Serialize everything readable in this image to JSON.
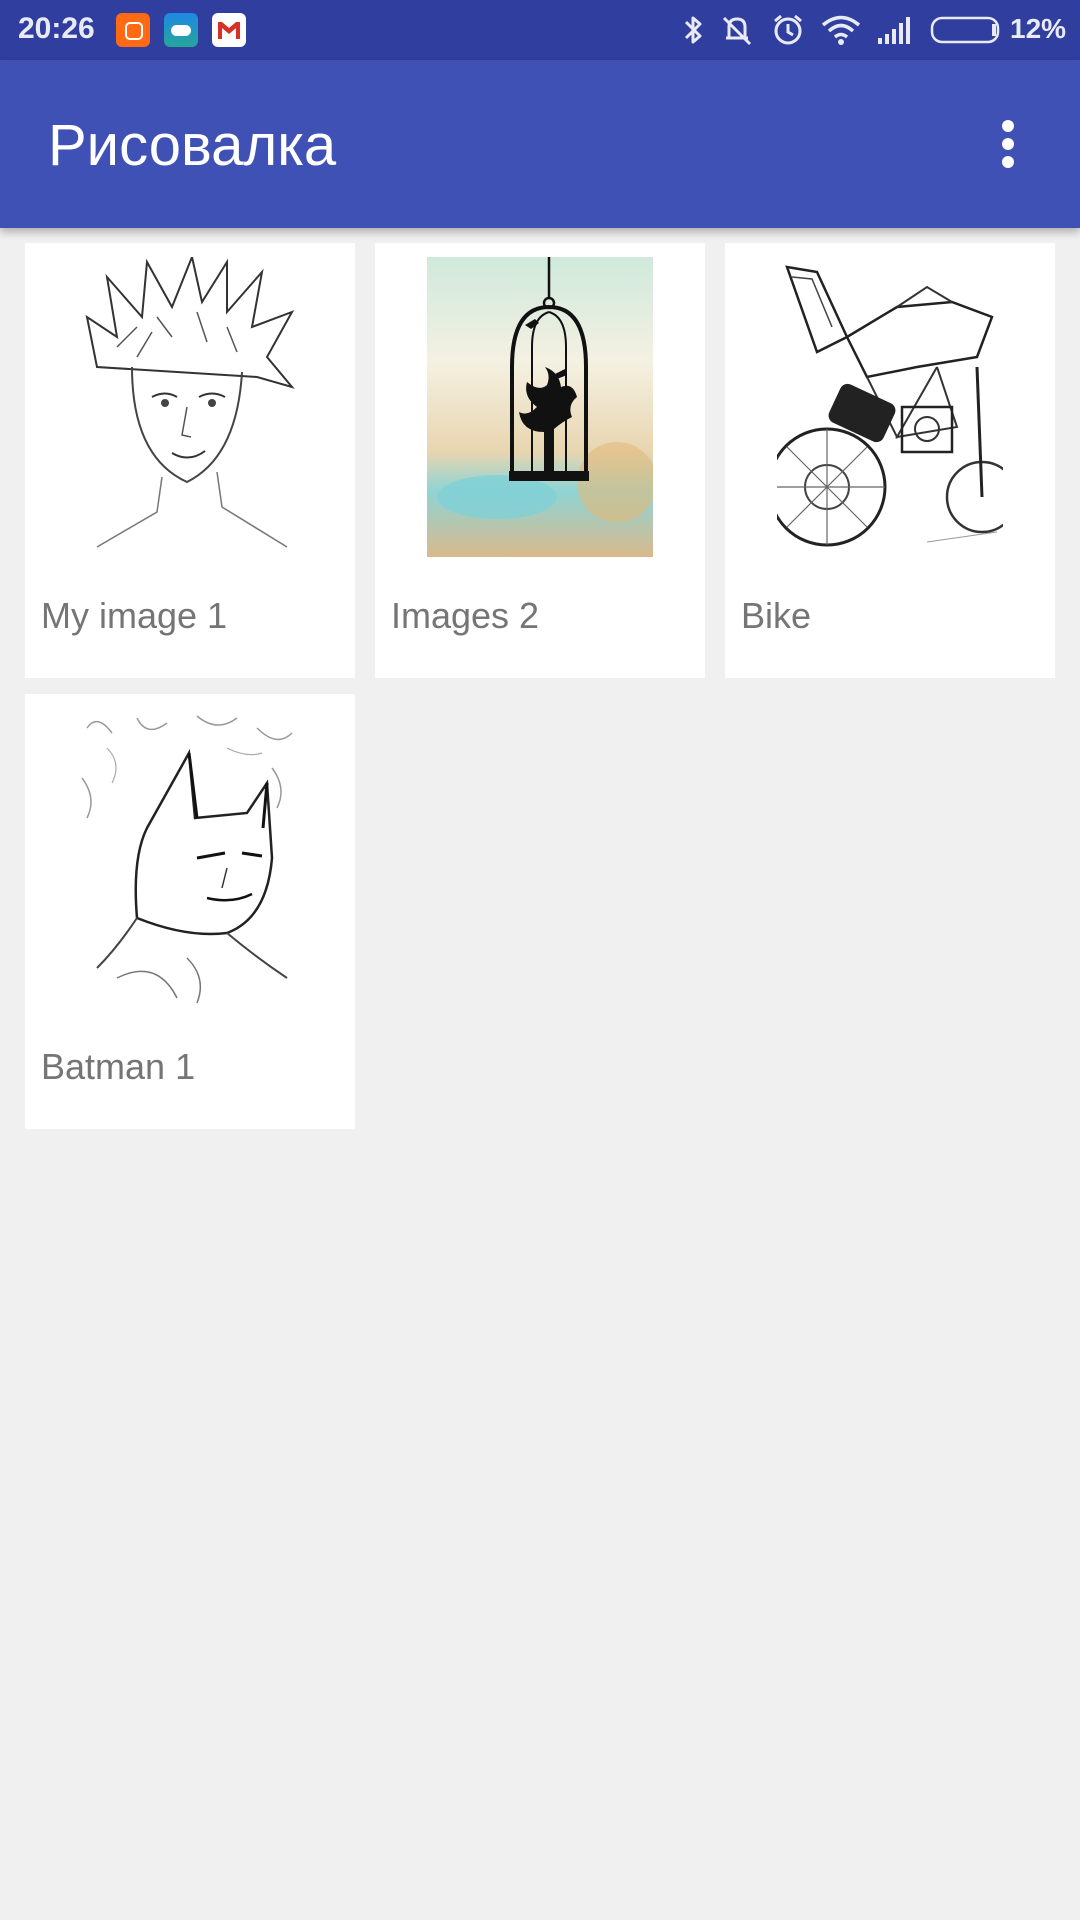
{
  "status_bar": {
    "time": "20:26",
    "battery_percent": "12%",
    "notification_icons": [
      "mi-app-icon",
      "weather-app-icon",
      "gmail-icon"
    ],
    "system_icons": [
      "bluetooth-icon",
      "vibrate-off-icon",
      "alarm-icon",
      "wifi-icon",
      "signal-icon",
      "battery-icon"
    ],
    "battery_level": 0.12
  },
  "app_bar": {
    "title": "Рисовалка",
    "overflow_icon": "more-vert-icon"
  },
  "gallery": {
    "items": [
      {
        "label": "My image 1",
        "thumbnail": "portrait-sketch-image"
      },
      {
        "label": "Images 2",
        "thumbnail": "birdcage-silhouette-image"
      },
      {
        "label": "Bike",
        "thumbnail": "motorcycle-sketch-image"
      },
      {
        "label": "Batman 1",
        "thumbnail": "batman-sketch-image"
      }
    ]
  },
  "colors": {
    "status_bar": "#303f9f",
    "app_bar": "#3f51b5",
    "background": "#f0f0f0",
    "card": "#ffffff",
    "label_text": "#757575"
  }
}
